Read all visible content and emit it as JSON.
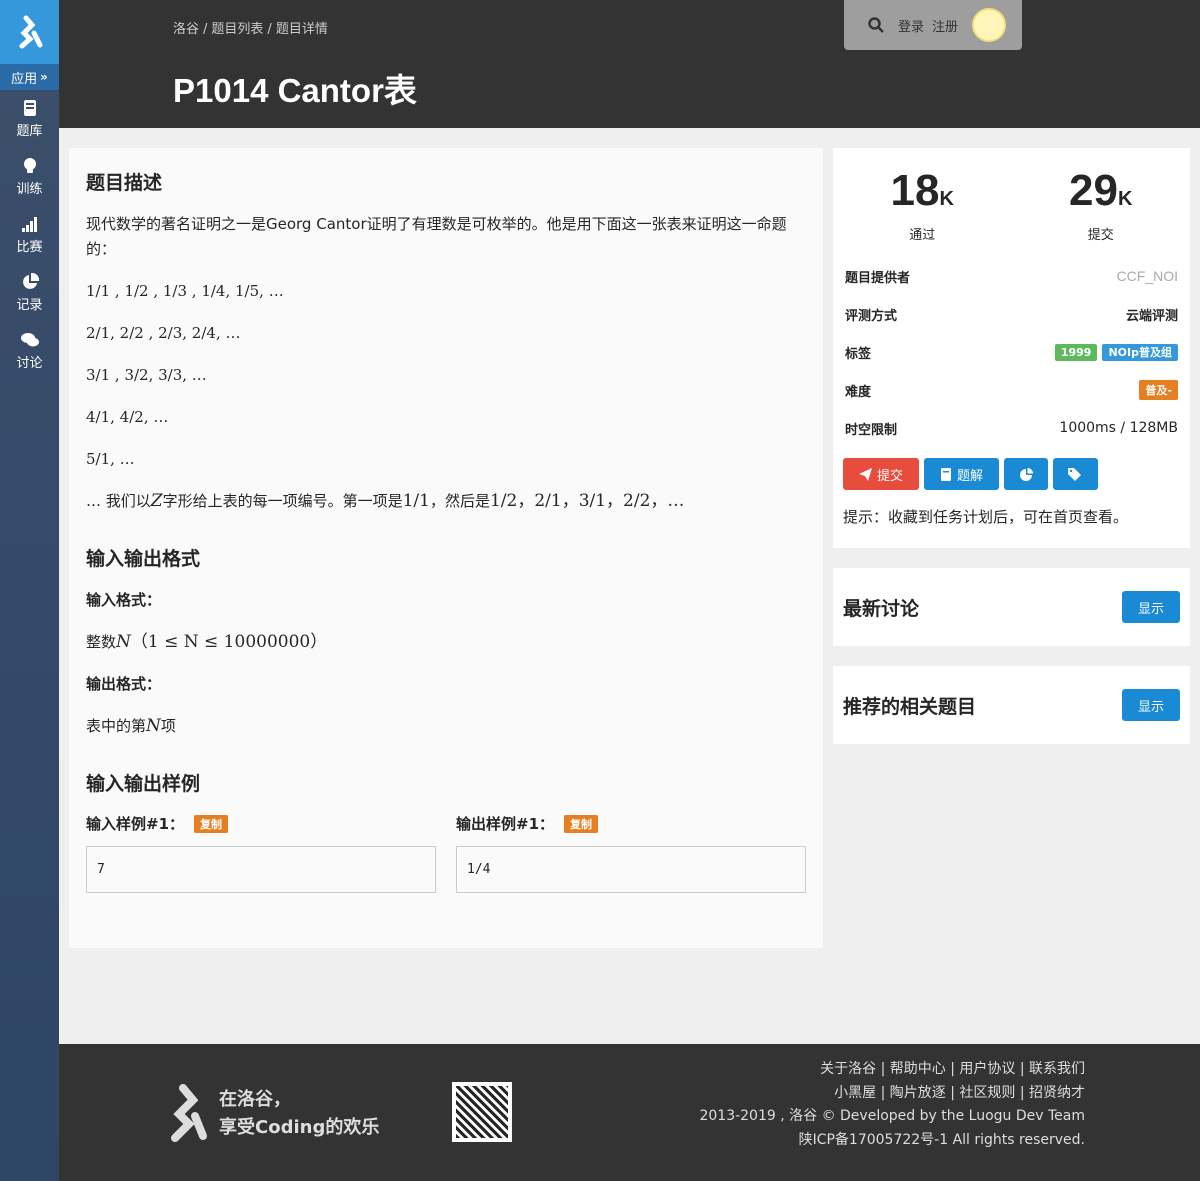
{
  "sidebar": {
    "apps_label": "应用",
    "items": [
      {
        "label": "题库",
        "icon": "book-icon"
      },
      {
        "label": "训练",
        "icon": "lightbulb-icon"
      },
      {
        "label": "比赛",
        "icon": "signal-bars-icon"
      },
      {
        "label": "记录",
        "icon": "pie-chart-icon"
      },
      {
        "label": "讨论",
        "icon": "comments-icon"
      }
    ]
  },
  "header": {
    "breadcrumb": [
      "洛谷",
      "题目列表",
      "题目详情"
    ],
    "title": "P1014 Cantor表",
    "login": "登录",
    "register": "注册"
  },
  "problem": {
    "desc_heading": "题目描述",
    "desc_text": "现代数学的著名证明之一是Georg Cantor证明了有理数是可枚举的。他是用下面这一张表来证明这一命题的：",
    "rows": [
      "1/1 , 1/2 , 1/3 , 1/4, 1/5, …",
      "2/1, 2/2 , 2/3, 2/4, …",
      "3/1 , 3/2, 3/3, …",
      "4/1, 4/2, …",
      "5/1, …"
    ],
    "numbering_prefix": "… 我们以",
    "numbering_var": "Z",
    "numbering_mid": "字形给上表的每一项编号。第一项是",
    "numbering_first": "1/1",
    "numbering_after": "，然后是",
    "numbering_seq": "1/2，2/1，3/1，2/2，…",
    "io_heading": "输入输出格式",
    "input_label": "输入格式：",
    "input_prefix": "整数",
    "input_var": "N",
    "input_range": "（1 ≤ N ≤ 10000000）",
    "output_label": "输出格式：",
    "output_prefix": "表中的第",
    "output_var": "N",
    "output_suffix": "项",
    "samples_heading": "输入输出样例",
    "sample_input_label": "输入样例#1：",
    "sample_output_label": "输出样例#1：",
    "copy_label": "复制",
    "sample_input": "7",
    "sample_output": "1/4"
  },
  "info": {
    "accepted_num": "18",
    "accepted_unit": "K",
    "accepted_label": "通过",
    "submit_num": "29",
    "submit_unit": "K",
    "submit_label": "提交",
    "provider_key": "题目提供者",
    "provider_val": "CCF_NOI",
    "judge_key": "评测方式",
    "judge_val": "云端评测",
    "tags_key": "标签",
    "tag1": "1999",
    "tag2": "NOIp普及组",
    "difficulty_key": "难度",
    "difficulty_val": "普及-",
    "limit_key": "时空限制",
    "limit_val": "1000ms / 128MB",
    "submit_btn": "提交",
    "solution_btn": "题解",
    "hint": "提示：收藏到任务计划后，可在首页查看。"
  },
  "discussion": {
    "title": "最新讨论",
    "show": "显示"
  },
  "related": {
    "title": "推荐的相关题目",
    "show": "显示"
  },
  "footer": {
    "slogan1": "在洛谷，",
    "slogan2": "享受Coding的欢乐",
    "links1": "关于洛谷 | 帮助中心 | 用户协议 | 联系我们",
    "links2": "小黑屋 | 陶片放逐 | 社区规则 | 招贤纳才",
    "copyright": "2013-2019 , 洛谷 © Developed by the Luogu Dev Team",
    "icp": "陕ICP备17005722号-1 All rights reserved."
  },
  "colors": {
    "accent": "#3498db",
    "submit_red": "#e74c3c",
    "blue_btn": "#1a8ad5",
    "tag_green": "#5eb95e",
    "tag_blue": "#3498db",
    "difficulty_orange": "#e67e22"
  }
}
